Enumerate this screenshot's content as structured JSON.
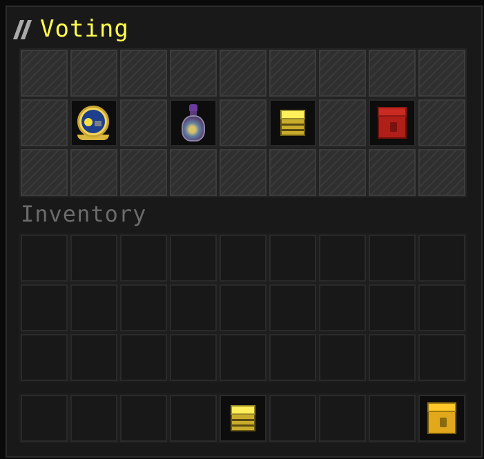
{
  "window": {
    "title": "Voting"
  },
  "gui": {
    "rows": [
      [
        {
          "kind": "filler"
        },
        {
          "kind": "filler"
        },
        {
          "kind": "filler"
        },
        {
          "kind": "filler"
        },
        {
          "kind": "filler"
        },
        {
          "kind": "filler"
        },
        {
          "kind": "filler"
        },
        {
          "kind": "filler"
        },
        {
          "kind": "filler"
        }
      ],
      [
        {
          "kind": "filler"
        },
        {
          "kind": "item",
          "icon": "clock-icon"
        },
        {
          "kind": "filler"
        },
        {
          "kind": "item",
          "icon": "potion-icon"
        },
        {
          "kind": "filler"
        },
        {
          "kind": "item",
          "icon": "yellow-crate-icon"
        },
        {
          "kind": "filler"
        },
        {
          "kind": "item",
          "icon": "red-block-icon"
        },
        {
          "kind": "filler"
        }
      ],
      [
        {
          "kind": "filler"
        },
        {
          "kind": "filler"
        },
        {
          "kind": "filler"
        },
        {
          "kind": "filler"
        },
        {
          "kind": "filler"
        },
        {
          "kind": "filler"
        },
        {
          "kind": "filler"
        },
        {
          "kind": "filler"
        },
        {
          "kind": "filler"
        }
      ]
    ]
  },
  "inventory": {
    "label": "Inventory",
    "rows": 3,
    "columns": 9
  },
  "hotbar": {
    "slots": [
      {
        "kind": "empty"
      },
      {
        "kind": "empty"
      },
      {
        "kind": "empty"
      },
      {
        "kind": "empty"
      },
      {
        "kind": "item",
        "icon": "yellow-crate-icon"
      },
      {
        "kind": "empty"
      },
      {
        "kind": "empty"
      },
      {
        "kind": "empty"
      },
      {
        "kind": "item",
        "icon": "gold-block-icon"
      }
    ]
  }
}
